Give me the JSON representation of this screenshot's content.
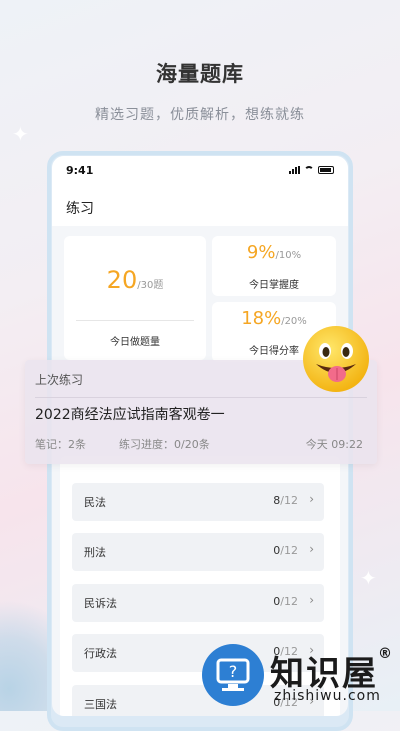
{
  "hero": {
    "title": "海量题库",
    "subtitle": "精选习题，优质解析，想练就练"
  },
  "status_bar": {
    "time": "9:41"
  },
  "nav": {
    "title": "练习"
  },
  "stats": {
    "questions": {
      "value": "20",
      "total": "/30题",
      "label": "今日做题量"
    },
    "mastery": {
      "value": "9%",
      "total": "/10%",
      "label": "今日掌握度"
    },
    "score_rate": {
      "value": "18%",
      "total": "/20%",
      "label": "今日得分率"
    }
  },
  "recent": {
    "header": "上次练习",
    "title": "2022商经法应试指南客观卷一",
    "notes": "笔记：2条",
    "progress": "练习进度：0/20条",
    "time": "今天 09:22"
  },
  "subjects": [
    {
      "name": "民法",
      "done": "8",
      "total": "/12"
    },
    {
      "name": "刑法",
      "done": "0",
      "total": "/12"
    },
    {
      "name": "民诉法",
      "done": "0",
      "total": "/12"
    },
    {
      "name": "行政法",
      "done": "0",
      "total": "/12"
    },
    {
      "name": "三国法",
      "done": "0",
      "total": "/12"
    }
  ],
  "watermark": {
    "name": "知识屋",
    "registered": "®",
    "url": "zhishiwu.com",
    "icon": "question-monitor-icon"
  },
  "colors": {
    "accent": "#f5a623",
    "brand_blue": "#2d7fd3"
  }
}
